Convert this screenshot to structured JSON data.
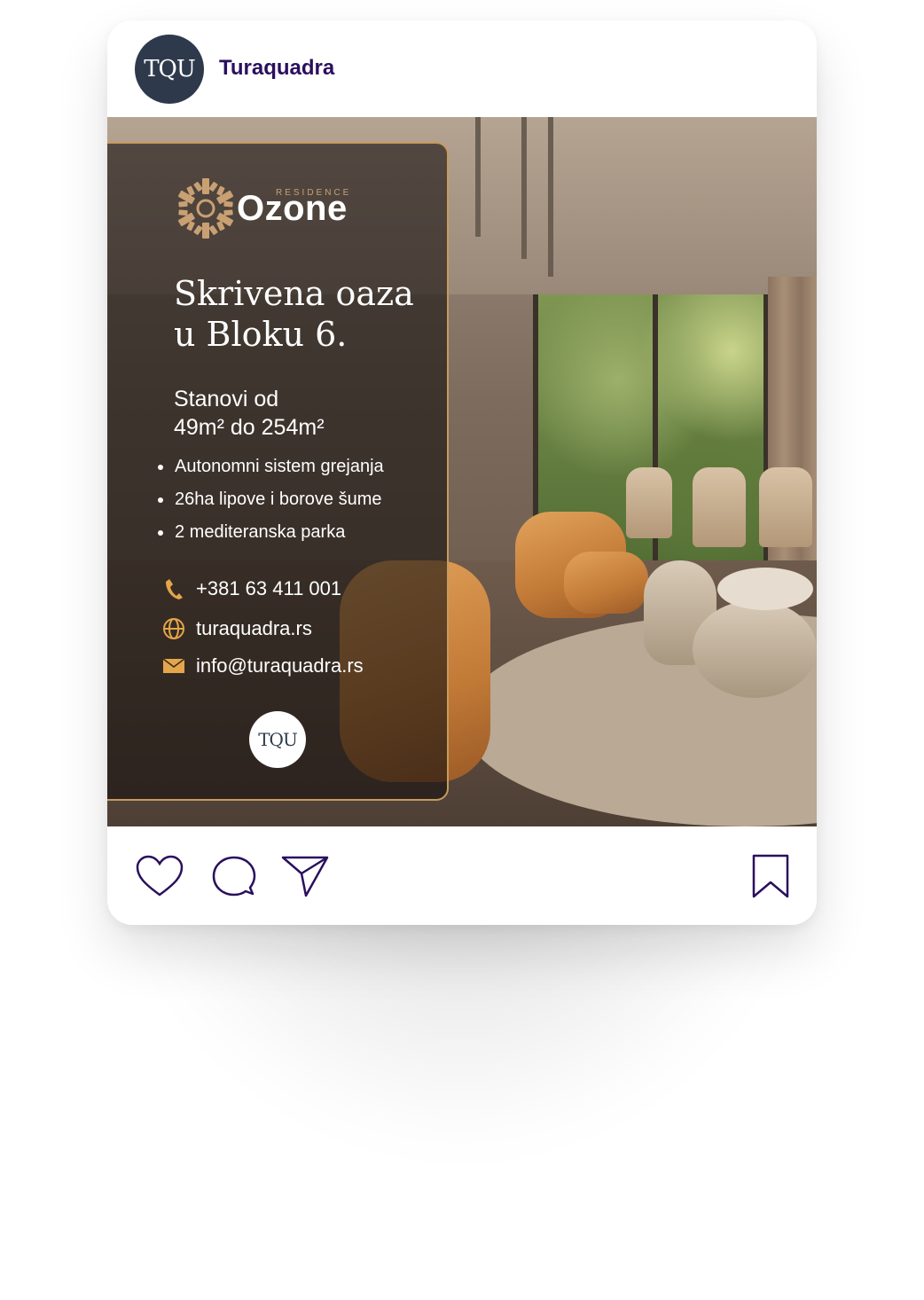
{
  "post": {
    "account": {
      "avatar_text": "TQU",
      "name": "Turaquadra"
    },
    "ad": {
      "brand_sub": "RESIDENCE",
      "brand_name": "Ozone",
      "headline": "Skrivena oaza\nu Bloku 6.",
      "size_text": "Stanovi od\n49m² do 254m²",
      "features": [
        "Autonomni sistem grejanja",
        "26ha lipove i borove šume",
        "2 mediteranska parka"
      ],
      "phone": "+381 63 411 001",
      "website": "turaquadra.rs",
      "email": "info@turaquadra.rs",
      "badge_text": "TQU",
      "accent_color": "#c79a5e"
    },
    "actions": {
      "icons": [
        "heart-icon",
        "comment-icon",
        "share-icon",
        "bookmark-icon"
      ],
      "icon_color": "#2a0f5e"
    }
  }
}
